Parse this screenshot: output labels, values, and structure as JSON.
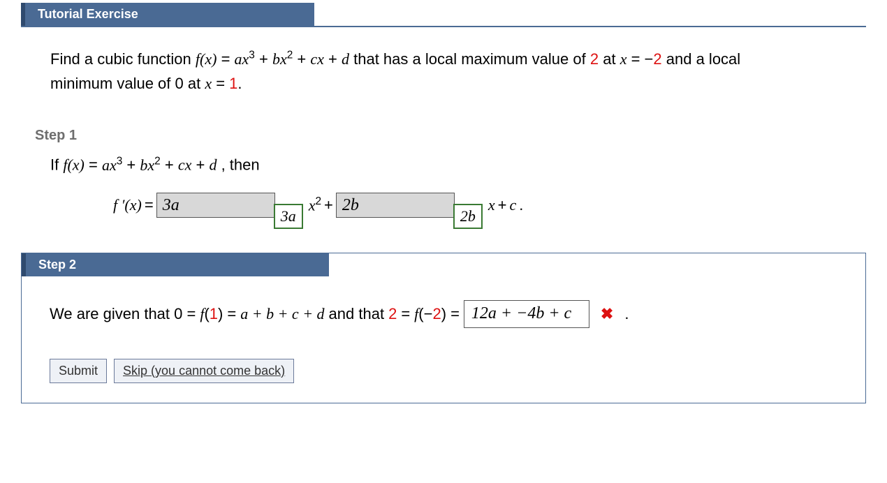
{
  "header": {
    "title": "Tutorial Exercise"
  },
  "problem": {
    "line1_a": "Find a cubic function ",
    "fx": "f(x)",
    "eq": " = ",
    "poly_a": "ax",
    "exp3": "3",
    "plus1": " + ",
    "poly_b": "bx",
    "exp2": "2",
    "plus2": " + ",
    "poly_c": "cx",
    "plus3": " + ",
    "poly_d": "d",
    "line1_b": " that has a local maximum value of ",
    "val2": "2",
    "line1_c": " at ",
    "xeq": "x",
    "eqm2": " = −",
    "m2": "2",
    "line1_d": " and a local",
    "line2_a": "minimum value of 0 at ",
    "xeq1": "x",
    "eq1": " = ",
    "v1": "1",
    "period": "."
  },
  "step1": {
    "label": "Step 1",
    "if": "If  ",
    "fx": "f(x)",
    "eq": " = ",
    "poly_a": "ax",
    "exp3": "3",
    "plus1": " + ",
    "poly_b": "bx",
    "exp2": "2",
    "plus2": " + ",
    "poly_c": "cx",
    "plus3": " + ",
    "poly_d": "d",
    "then": ",  then",
    "fprime": "f ′(x)",
    "eq2": " = ",
    "ans1": "3a",
    "tag1": "3a",
    "x2": "x",
    "x2exp": "2",
    "plusA": " + ",
    "ans2": "2b",
    "tag2": "2b",
    "xB": "x",
    "plusB": " + ",
    "cterm": "c",
    "periodB": "."
  },
  "step2": {
    "label": "Step 2",
    "t1": "We are given that  0 = ",
    "f1": "f",
    "p1a": "(",
    "one": "1",
    "p1b": ")",
    "t2": " = ",
    "sum": "a + b + c + d",
    "t3": "  and that  ",
    "two": "2",
    "t4": " = ",
    "fm2": "f",
    "pm2a": "(−",
    "m2": "2",
    "pm2b": ")",
    "t5": " = ",
    "input_value": "12a + −4b + c",
    "wrong_mark": "✖",
    "period": "."
  },
  "buttons": {
    "submit": "Submit",
    "skip": "Skip (you cannot come back)"
  }
}
